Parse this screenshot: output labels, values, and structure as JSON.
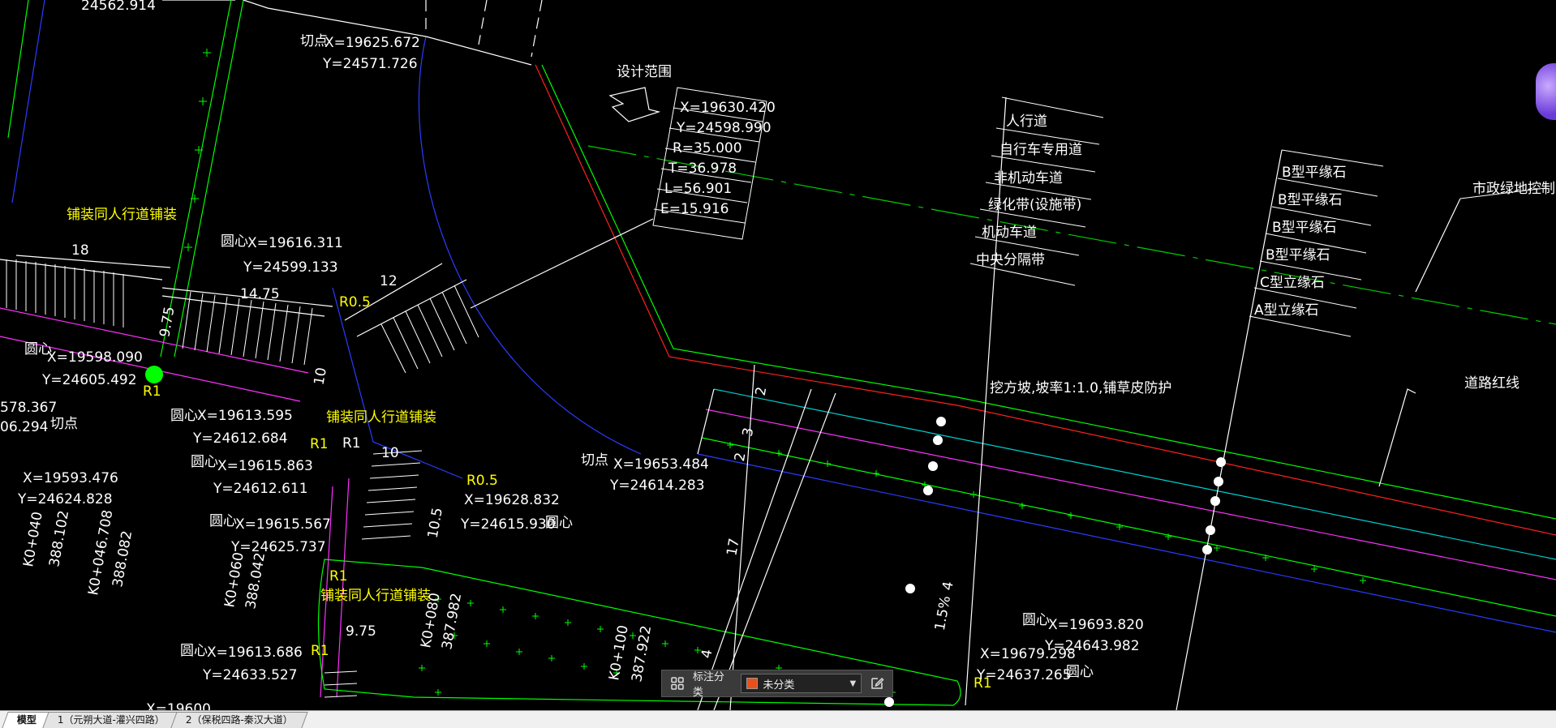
{
  "app": {
    "accent": "#5a2fd1"
  },
  "drawing": {
    "labels": {
      "top_y": "24562.914",
      "tangent_1": {
        "title": "切点",
        "x": "X=19625.672",
        "y": "Y=24571.726"
      },
      "design_range": "设计范围",
      "curve_table": [
        "X=19630.420",
        "Y=24598.990",
        "R=35.000",
        "T=36.978",
        "L=56.901",
        "E=15.916"
      ],
      "road_layers": [
        "人行道",
        "自行车专用道",
        "非机动车道",
        "绿化带(设施带)",
        "机动车道",
        "中央分隔带"
      ],
      "curb_types": [
        "B型平缘石",
        "B型平缘石",
        "B型平缘石",
        "B型平缘石",
        "C型立缘石",
        "A型立缘石"
      ],
      "green_control_line": "市政绿地控制线",
      "road_red_line": "道路红线",
      "excavation_note": "挖方坡,坡率1:1.0,铺草皮防护",
      "paving_1": "铺装同人行道铺装",
      "paving_2": "铺装同人行道铺装",
      "paving_3": "铺装同人行道铺装",
      "dim_18": "18",
      "dim_14_75": "14.75",
      "dim_9_75_v": "9.75",
      "dim_12": "12",
      "dim_10_v": "10",
      "dim_10": "10",
      "dim_10_5": "10.5",
      "dim_9_75": "9.75",
      "dim_17": "17",
      "dim_2": "2",
      "dim_3": "3",
      "dim_2b": "2",
      "dim_slope": "1.5%",
      "dim_4": "4",
      "dim_4b": "4",
      "r05_a": "R0.5",
      "r05_b": "R0.5",
      "r1_a": "R1",
      "r1_b": "R1",
      "r1_c": "R1",
      "r1_d": "R1",
      "r1_e": "R1",
      "r1_f": "R1",
      "center_1": {
        "title": "圆心",
        "x": "X=19616.311",
        "y": "Y=24599.133"
      },
      "center_2": {
        "title": "圆心",
        "x": "X=19598.090",
        "y": "Y=24605.492"
      },
      "center_3": {
        "title": "圆心",
        "x": "X=19613.595",
        "y": "Y=24612.684"
      },
      "center_4": {
        "title": "圆心",
        "x": "X=19615.863",
        "y": "Y=24612.611"
      },
      "center_5": {
        "title": "圆心",
        "x": "X=19615.567",
        "y": "Y=24625.737"
      },
      "center_6": {
        "title": "圆心",
        "x": "X=19613.686",
        "y": "Y=24633.527"
      },
      "center_7": {
        "title": "圆心",
        "x": "X=19628.832",
        "y": "Y=24615.930"
      },
      "center_8": {
        "title": "圆心",
        "x": "X=19693.820",
        "y": "Y=24643.982"
      },
      "center_9": {
        "title": "圆心",
        "x": "X=19679.298",
        "y": "Y=24637.265"
      },
      "tangent_2": {
        "title": "切点",
        "x": "X=19653.484",
        "y": "Y=24614.283"
      },
      "point_left": {
        "x": "X=19593.476",
        "y": "Y=24624.828"
      },
      "left_cut_1": "578.367",
      "left_cut_2": "06.294",
      "left_cut_title": "切点",
      "chain_1": "K0+040",
      "chain_1_v": "388.102",
      "chain_2": "K0+046.708",
      "chain_2_v": "388.082",
      "chain_3": "K0+060",
      "chain_3_v": "388.042",
      "chain_4": "K0+080",
      "chain_4_v": "387.982",
      "chain_5": "K0+100",
      "chain_5_v": "387.922",
      "bottom_left_x": "X=19600"
    }
  },
  "toolbar": {
    "label": "标注分类",
    "selected": "未分类",
    "swatch_color": "#e8501c"
  },
  "tabs": [
    {
      "label": "模型"
    },
    {
      "label": "1（元朔大道-灌兴四路）"
    },
    {
      "label": "2（保税四路-秦汉大道）"
    }
  ]
}
